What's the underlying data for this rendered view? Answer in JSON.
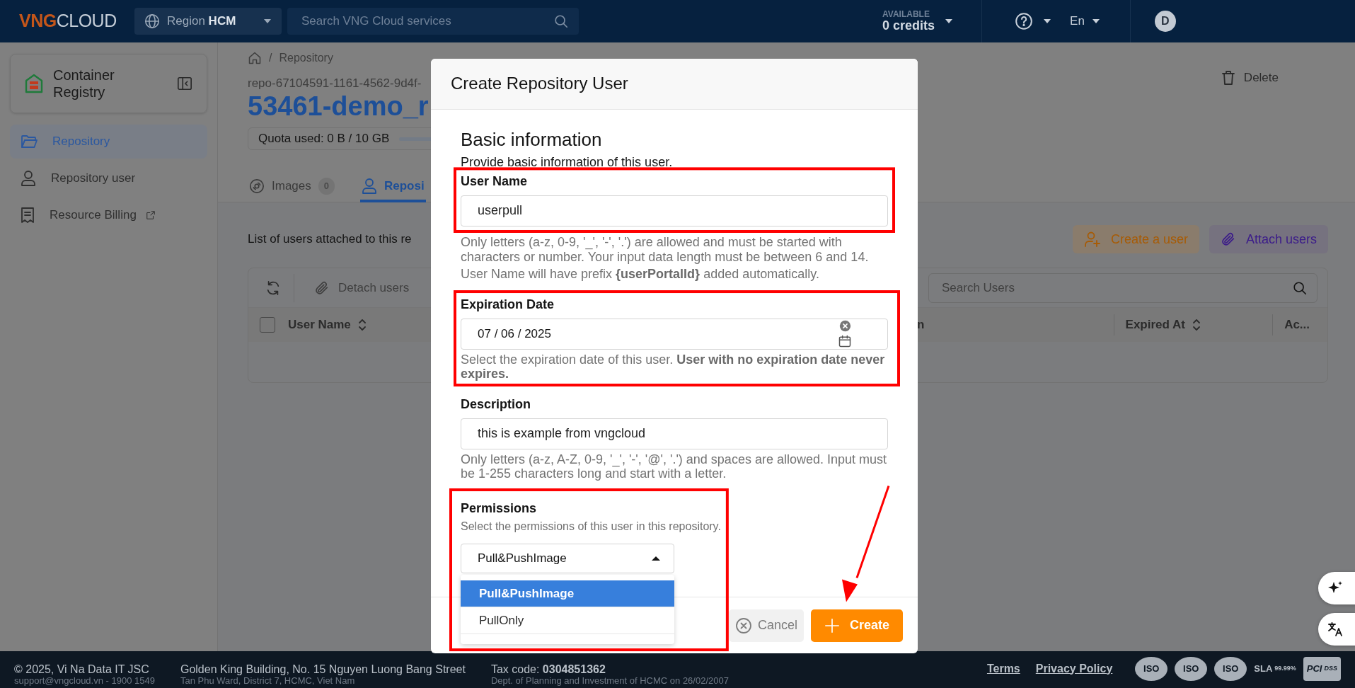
{
  "top_bar": {
    "logo": {
      "part_1": "VNG",
      "part_2": "CLOUD"
    },
    "region": {
      "label": "Region",
      "value": "HCM"
    },
    "search": {
      "placeholder": "Search VNG Cloud services"
    },
    "credits": {
      "caption": "AVAILABLE",
      "value": "0 credits"
    },
    "language": "En",
    "avatar": "D"
  },
  "sidebar": {
    "title": "Container Registry",
    "items": [
      {
        "label": "Repository",
        "selected": true,
        "kind": "folder",
        "external": false
      },
      {
        "label": "Repository user",
        "selected": false,
        "kind": "user",
        "external": false
      },
      {
        "label": "Resource Billing",
        "selected": false,
        "kind": "receipt",
        "external": true
      }
    ]
  },
  "main": {
    "breadcrumb": {
      "separator": "/",
      "current": "Repository"
    },
    "repo_id": "repo-67104591-1161-4562-9d4f-",
    "title": "53461-demo_r",
    "quota": {
      "label": "Quota used: 0 B / 10 GB",
      "level": 0
    },
    "delete_button": "Delete",
    "tabs": [
      {
        "label": "Images",
        "count": "0",
        "selected": false,
        "kind": "images"
      },
      {
        "label": "Reposi",
        "selected": true,
        "kind": "user"
      }
    ],
    "list_caption": "List of users attached to this re",
    "actions": [
      {
        "label": "Create a user",
        "kind": "create"
      },
      {
        "label": "Attach users",
        "kind": "attach"
      }
    ],
    "table": {
      "detach_button": {
        "label": "Detach users",
        "disabled": true
      },
      "search": {
        "placeholder": "Search Users"
      },
      "select_all": {
        "checked": false
      },
      "columns": [
        {
          "label": "User Name",
          "sortable": true
        },
        {
          "label": "n",
          "sortable": false
        },
        {
          "label": "Expired At",
          "sortable": true
        },
        {
          "label": "Ac...",
          "sortable": false
        }
      ]
    }
  },
  "dialog": {
    "title": "Create Repository User",
    "section_title": "Basic information",
    "section_hint": "Provide basic information of this user.",
    "fields": [
      {
        "kind": "text",
        "label": "User Name",
        "value": "userpull",
        "help": [
          "Only letters (a-z, 0-9, '_', '-', '.') are allowed and must be started with characters or number. Your input data length must be between 6 and 14.",
          "User Name will have prefix **{userPortalId}** added automatically."
        ]
      },
      {
        "kind": "date",
        "label": "Expiration Date",
        "value": "07 / 06 / 2025",
        "help": [
          "Select the expiration date of this user. **User with no expiration date never expires.**"
        ]
      },
      {
        "kind": "text",
        "label": "Description",
        "value": "this is example from vngcloud",
        "help": [
          "Only letters (a-z, A-Z, 0-9, '_', '-', '@', '.') and spaces are allowed. Input must be 1-255 characters long and start with a letter."
        ]
      },
      {
        "kind": "select",
        "label": "Permissions",
        "hint": "Select the permissions of this user in this repository.",
        "value": "Pull&PushImage",
        "expanded": true,
        "options": [
          {
            "label": "Pull&PushImage",
            "selected": true
          },
          {
            "label": "PullOnly",
            "selected": false
          }
        ]
      }
    ],
    "buttons": [
      {
        "label": "Cancel",
        "kind": "cancel"
      },
      {
        "label": "Create",
        "kind": "primary"
      }
    ]
  },
  "footer": {
    "company": {
      "name": "© 2025, Vi Na Data IT JSC",
      "contact": "support@vngcloud.vn - 1900 1549"
    },
    "address": {
      "line_1": "Golden King Building, No. 15 Nguyen Luong Bang Street",
      "line_2": "Tan Phu Ward, District 7, HCMC, Viet Nam"
    },
    "tax": {
      "line_1": "Tax code: **0304851362**",
      "line_2": "Dept. of Planning and Investment of HCMC on 26/02/2007"
    },
    "links": [
      "Terms",
      "Privacy Policy"
    ],
    "badges": [
      {
        "kind": "iso",
        "label": "ISO"
      },
      {
        "kind": "iso",
        "label": "ISO"
      },
      {
        "kind": "iso",
        "label": "ISO"
      },
      {
        "kind": "sla",
        "label": "SLA",
        "sub": "99.99%"
      },
      {
        "kind": "pci",
        "label": "PCI",
        "sub": "DSS"
      }
    ]
  }
}
